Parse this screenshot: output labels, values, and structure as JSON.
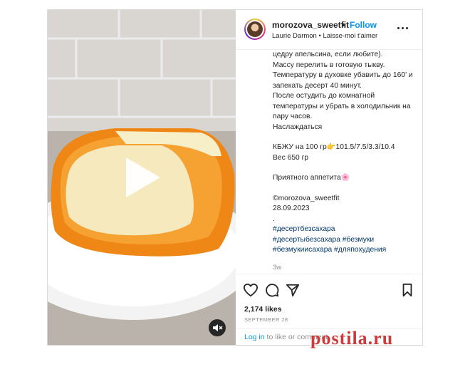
{
  "post": {
    "username": "morozova_sweetfit",
    "separator": "•",
    "follow_label": "Follow",
    "audio_label": "Laurie Darmon • Laisse-moi t'aimer",
    "caption_text": "цедру апельсина, если любите).\nМассу перелить в готовую тыкву.\nТемпературу в духовке убавить до 160’ и запекать десерт 40 минут.\nПосле остудить до комнатной температуры и убрать в холодильник на пару часов.\nНаслаждаться",
    "kbju_text": "КБЖУ на 100 гр👉101.5/7.5/3.3/10.4\nВес 650 гр",
    "appetite_text": "Приятного аппетита🌸",
    "signature_text": "©morozova_sweetfit\n28.09.2023\n.",
    "hashtags": [
      "#десертбезсахара",
      "#десертыбезсахара #безмуки",
      "#безмукиисахара #дляпохудения"
    ],
    "age": "3w",
    "likes": "2,174 likes",
    "date": "SEPTEMBER 28",
    "comment_login": "Log in",
    "comment_rest": " to like or comment."
  },
  "icons": {
    "more": "more-options-icon",
    "like": "heart-icon",
    "comment": "comment-icon",
    "share": "share-icon",
    "save": "bookmark-icon",
    "play": "play-icon",
    "mute": "muted-icon"
  },
  "colors": {
    "accent": "#0095f6",
    "hashtag": "#00376b",
    "pumpkin": "#f08a12",
    "custard": "#f6e9b8",
    "watermark": "#cf3a3a"
  },
  "watermark": "postila.ru"
}
